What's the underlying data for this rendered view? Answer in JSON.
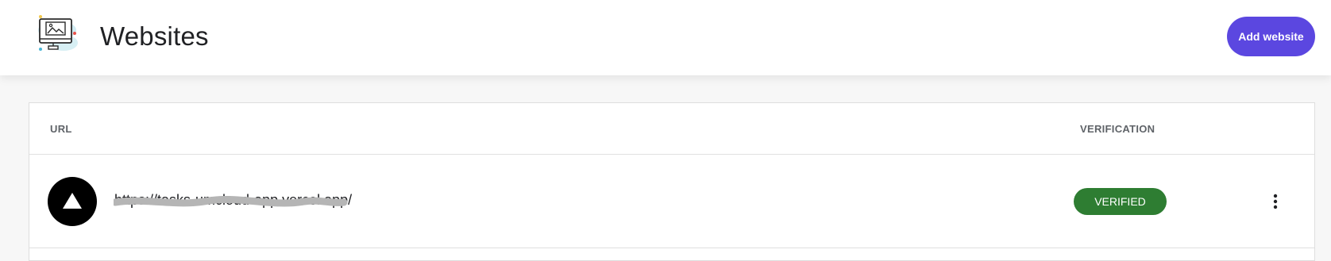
{
  "header": {
    "title": "Websites",
    "logo_icon": "website-illustration-icon",
    "add_button_label": "Add website"
  },
  "table": {
    "columns": {
      "url": "URL",
      "verification": "VERIFICATION"
    },
    "rows": [
      {
        "url": "https://tasks-umcloud-app.vercel.app/",
        "avatar_icon": "triangle-logo-icon",
        "status": "VERIFIED",
        "actions_icon": "more-vertical-icon"
      }
    ]
  },
  "colors": {
    "primary": "#5b47e0",
    "verified": "#2e7d32",
    "background": "#f7f7f7"
  }
}
